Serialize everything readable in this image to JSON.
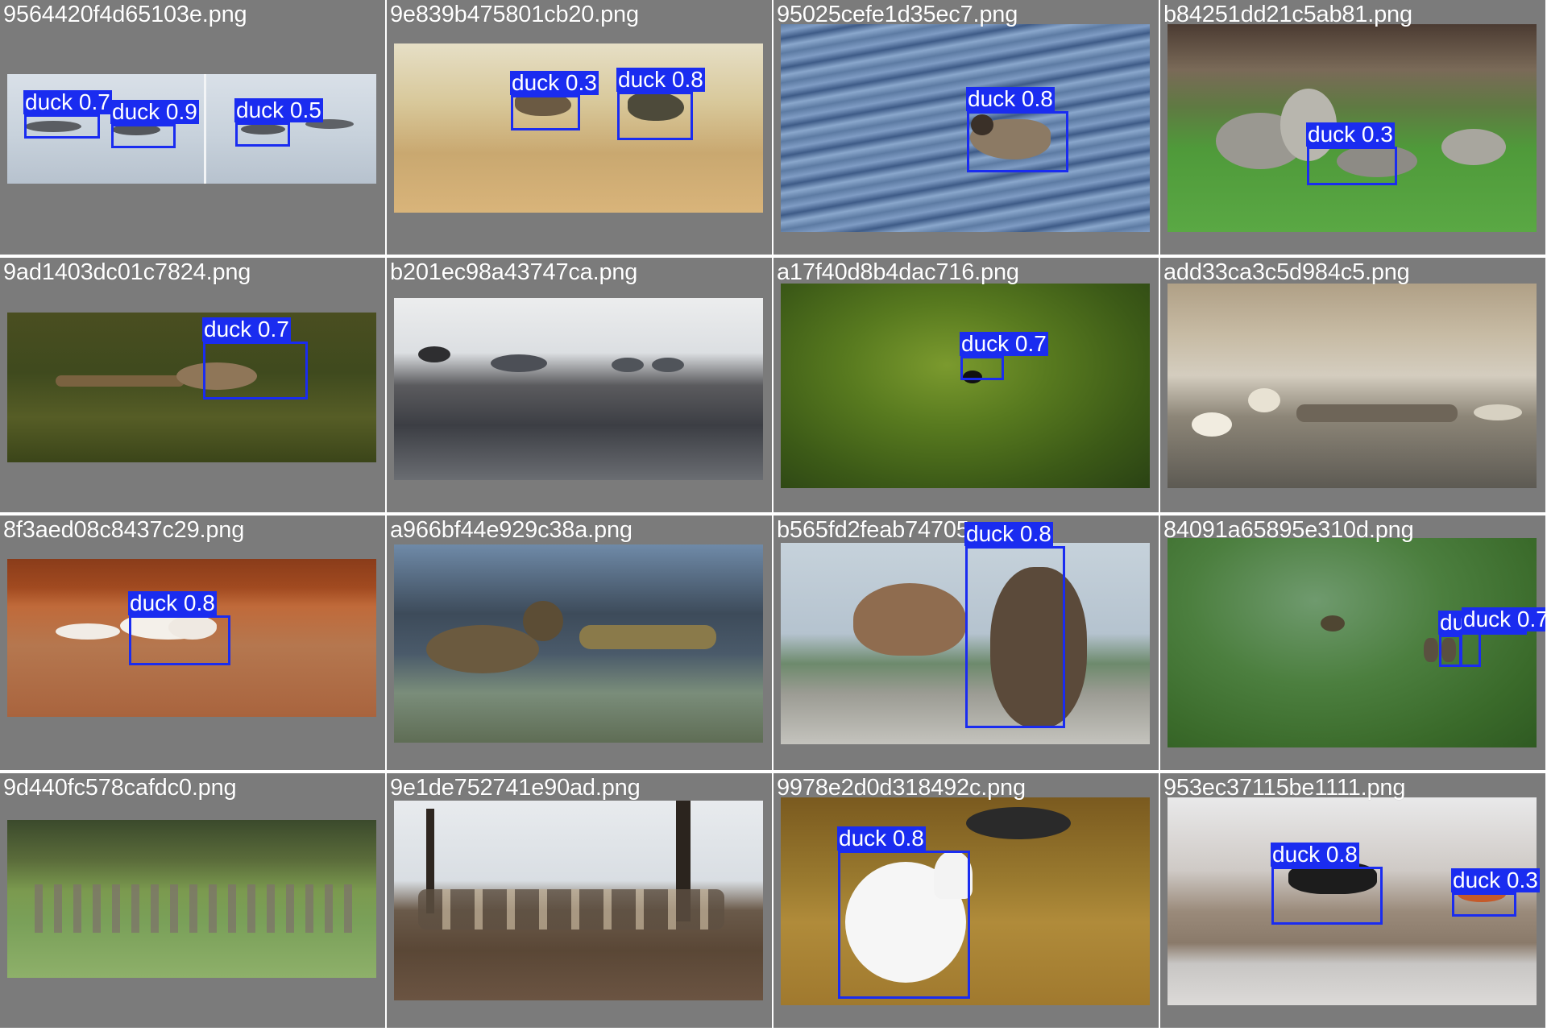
{
  "colors": {
    "tile_background": "#7b7b7b",
    "box_color": "#1a2cf0",
    "label_text": "#ffffff"
  },
  "tiles": [
    {
      "filename": "9564420f4d65103e.png",
      "scene": "ducks on pale water",
      "detections": [
        {
          "label": "duck 0.7"
        },
        {
          "label": "duck 0.9"
        },
        {
          "label": "duck 0.5"
        }
      ]
    },
    {
      "filename": "9e839b475801cb20.png",
      "scene": "ducks flying over grass",
      "detections": [
        {
          "label": "duck 0.3"
        },
        {
          "label": "duck 0.8"
        }
      ]
    },
    {
      "filename": "95025cefe1d35ec7.png",
      "scene": "duck on rippled water",
      "detections": [
        {
          "label": "duck 0.8"
        }
      ]
    },
    {
      "filename": "b84251dd21c5ab81.png",
      "scene": "geese on lawn",
      "detections": [
        {
          "label": "duck 0.3"
        }
      ]
    },
    {
      "filename": "9ad1403dc01c7824.png",
      "scene": "duck and ducklings on water",
      "detections": [
        {
          "label": "duck 0.7"
        }
      ]
    },
    {
      "filename": "b201ec98a43747ca.png",
      "scene": "ducks on icy water",
      "detections": []
    },
    {
      "filename": "a17f40d8b4dac716.png",
      "scene": "duck on green wave",
      "detections": [
        {
          "label": "duck 0.7"
        }
      ]
    },
    {
      "filename": "add33ca3c5d984c5.png",
      "scene": "swans on misty lake",
      "detections": []
    },
    {
      "filename": "8f3aed08c8437c29.png",
      "scene": "swans taking off",
      "detections": [
        {
          "label": "duck 0.8"
        }
      ]
    },
    {
      "filename": "a966bf44e929c38a.png",
      "scene": "duck with ducklings",
      "detections": []
    },
    {
      "filename": "b565fd2feab74705.png",
      "scene": "ducks on rocks",
      "detections": [
        {
          "label": "duck 0.8"
        }
      ]
    },
    {
      "filename": "84091a65895e310d.png",
      "scene": "ducks on green water",
      "detections": [
        {
          "label": "duck 0.5"
        },
        {
          "label": "duck 0.7"
        }
      ]
    },
    {
      "filename": "9d440fc578cafdc0.png",
      "scene": "geese in park",
      "detections": []
    },
    {
      "filename": "9e1de752741e90ad.png",
      "scene": "canada geese near trees",
      "detections": []
    },
    {
      "filename": "9978e2d0d318492c.png",
      "scene": "swan and duck on pond",
      "detections": [
        {
          "label": "duck 0.8"
        }
      ]
    },
    {
      "filename": "953ec37115be1111.png",
      "scene": "birds on sand bar",
      "detections": [
        {
          "label": "duck 0.8"
        },
        {
          "label": "duck 0.3"
        }
      ]
    }
  ]
}
